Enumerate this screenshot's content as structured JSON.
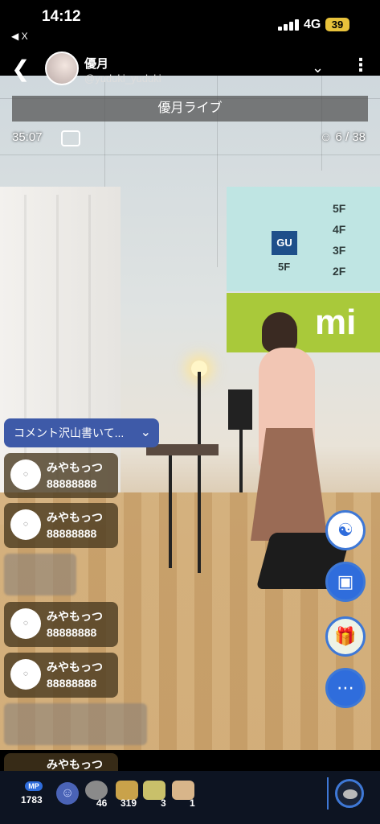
{
  "status_bar": {
    "time": "14:12",
    "back_app": "◀ X",
    "network": "4G",
    "battery": "39"
  },
  "header": {
    "username": "優月",
    "user_id": "@yuduki_yuduki"
  },
  "stream": {
    "title": "優月ライブ",
    "elapsed": "35:07",
    "viewers": "6 / 38"
  },
  "comment_prompt": {
    "label": "コメント沢山書いて..."
  },
  "comments": [
    {
      "name": "みやもっつ",
      "text": "88888888"
    },
    {
      "name": "みやもっつ",
      "text": "88888888"
    },
    {
      "name": "みやもっつ",
      "text": "88888888"
    },
    {
      "name": "みやもっつ",
      "text": "88888888"
    },
    {
      "name": "みやもっつ",
      "text": ""
    }
  ],
  "scene_text": {
    "floors": [
      "5F",
      "4F",
      "3F",
      "2F"
    ],
    "store_logo": "GU",
    "store_floor": "5F",
    "banner": "mi"
  },
  "bottom_bar": {
    "mp_label": "MP",
    "mp_count": "1783",
    "gifts": [
      {
        "icon": "stone-icon",
        "count": "46"
      },
      {
        "icon": "tower-icon",
        "count": "319"
      },
      {
        "icon": "cards-icon",
        "count": "3"
      },
      {
        "icon": "card-icon",
        "count": "1"
      }
    ]
  },
  "colors": {
    "accent": "#3e78d6",
    "prompt_bg": "#3e5aa8",
    "battery": "#e8c23b"
  }
}
